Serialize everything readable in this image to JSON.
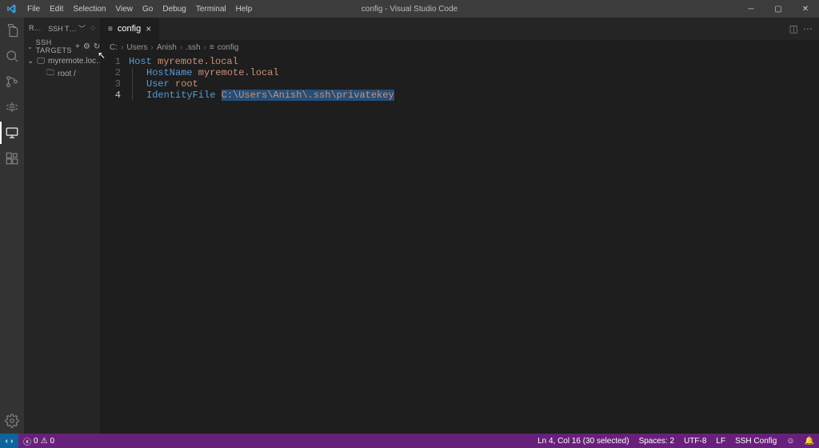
{
  "title": "config - Visual Studio Code",
  "menu": {
    "file": "File",
    "edit": "Edit",
    "selection": "Selection",
    "view": "View",
    "go": "Go",
    "debug": "Debug",
    "terminal": "Terminal",
    "help": "Help"
  },
  "sidebar": {
    "panel_label": "REMOT…",
    "dropdown": "SSH T…",
    "section": "SSH TARGETS",
    "host": "myremote.loc…",
    "child": "root /"
  },
  "tab": {
    "filename": "config"
  },
  "breadcrumbs": {
    "p0": "C:",
    "p1": "Users",
    "p2": "Anish",
    "p3": ".ssh",
    "p4": "config"
  },
  "code": {
    "l1_kw": "Host",
    "l1_v": " myremote.local",
    "l2_kw": "HostName",
    "l2_v": " myremote.local",
    "l3_kw": "User",
    "l3_v": " root",
    "l4_kw": "IdentityFile",
    "l4_sp": " ",
    "l4_sel": "C:\\Users\\Anish\\.ssh\\privatekey"
  },
  "gutter": {
    "l1": "1",
    "l2": "2",
    "l3": "3",
    "l4": "4"
  },
  "status": {
    "errors": "0",
    "warnings": "0",
    "cursor": "Ln 4, Col 16 (30 selected)",
    "spaces": "Spaces: 2",
    "encoding": "UTF-8",
    "eol": "LF",
    "lang": "SSH Config"
  }
}
